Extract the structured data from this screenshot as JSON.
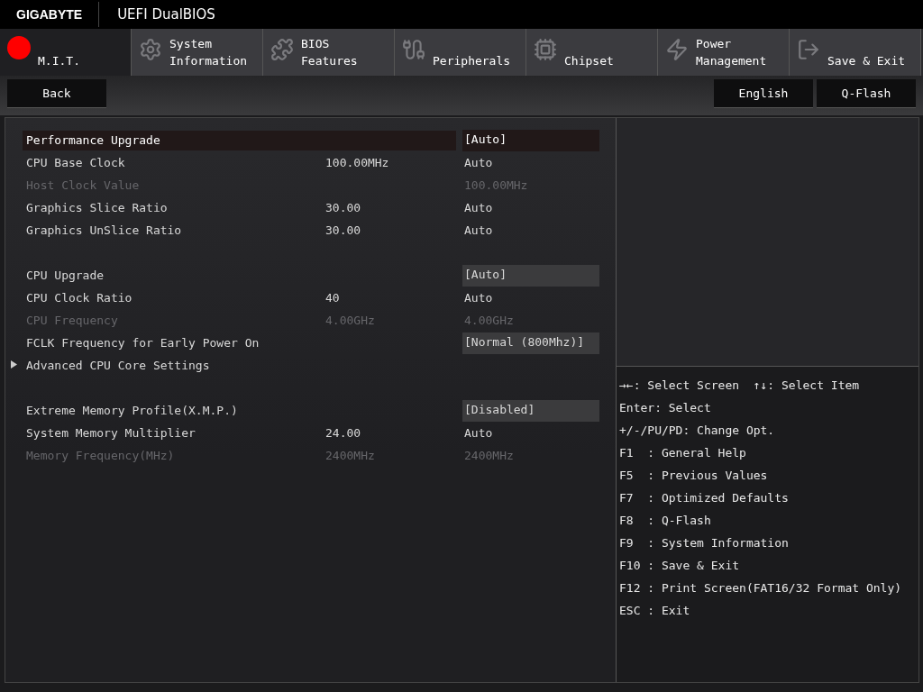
{
  "header": {
    "brand": "GIGABYTE",
    "title": "UEFI DualBIOS"
  },
  "tabs": [
    {
      "label": "M.I.T.",
      "selected": true
    },
    {
      "label": "System\nInformation",
      "selected": false
    },
    {
      "label": "BIOS\nFeatures",
      "selected": false
    },
    {
      "label": "Peripherals",
      "selected": false
    },
    {
      "label": "Chipset",
      "selected": false
    },
    {
      "label": "Power\nManagement",
      "selected": false
    },
    {
      "label": "Save & Exit",
      "selected": false
    }
  ],
  "toolbar": {
    "back": "Back",
    "right_buttons": [
      "English",
      "Q-Flash"
    ]
  },
  "settings": [
    {
      "kind": "option",
      "label": "Performance Upgrade",
      "value": "[Auto]",
      "selected": true,
      "disabled": false
    },
    {
      "kind": "setting",
      "label": "CPU Base Clock",
      "current": "100.00MHz",
      "value": "Auto",
      "selected": false,
      "disabled": false
    },
    {
      "kind": "setting",
      "label": "Host Clock Value",
      "value": "100.00MHz",
      "selected": false,
      "disabled": true
    },
    {
      "kind": "setting",
      "label": "Graphics Slice Ratio",
      "current": "30.00",
      "value": "Auto",
      "selected": false,
      "disabled": false
    },
    {
      "kind": "setting",
      "label": "Graphics UnSlice Ratio",
      "current": "30.00",
      "value": "Auto",
      "selected": false,
      "disabled": false
    },
    {
      "kind": "spacer"
    },
    {
      "kind": "option",
      "label": "CPU Upgrade",
      "value": "[Auto]",
      "selected": false,
      "disabled": false
    },
    {
      "kind": "setting",
      "label": "CPU Clock Ratio",
      "current": "40",
      "value": "Auto",
      "selected": false,
      "disabled": false
    },
    {
      "kind": "setting",
      "label": "CPU Frequency",
      "current": "4.00GHz",
      "value": "4.00GHz",
      "selected": false,
      "disabled": true
    },
    {
      "kind": "option",
      "label": "FCLK Frequency for Early Power On",
      "value": "[Normal (800Mhz)]",
      "selected": false,
      "disabled": false
    },
    {
      "kind": "submenu",
      "label": "Advanced CPU Core Settings",
      "selected": false
    },
    {
      "kind": "spacer"
    },
    {
      "kind": "option",
      "label": "Extreme Memory Profile(X.M.P.)",
      "value": "[Disabled]",
      "selected": false,
      "disabled": false
    },
    {
      "kind": "setting",
      "label": "System Memory Multiplier",
      "current": "24.00",
      "value": "Auto",
      "selected": false,
      "disabled": false
    },
    {
      "kind": "setting",
      "label": "Memory Frequency(MHz)",
      "current": "2400MHz",
      "value": "2400MHz",
      "selected": false,
      "disabled": true
    }
  ],
  "help": [
    "→←: Select Screen  ↑↓: Select Item",
    "Enter: Select",
    "+/-/PU/PD: Change Opt.",
    "F1  : General Help",
    "F5  : Previous Values",
    "F7  : Optimized Defaults",
    "F8  : Q-Flash",
    "F9  : System Information",
    "F10 : Save & Exit",
    "F12 : Print Screen(FAT16/32 Format Only)",
    "ESC : Exit"
  ]
}
